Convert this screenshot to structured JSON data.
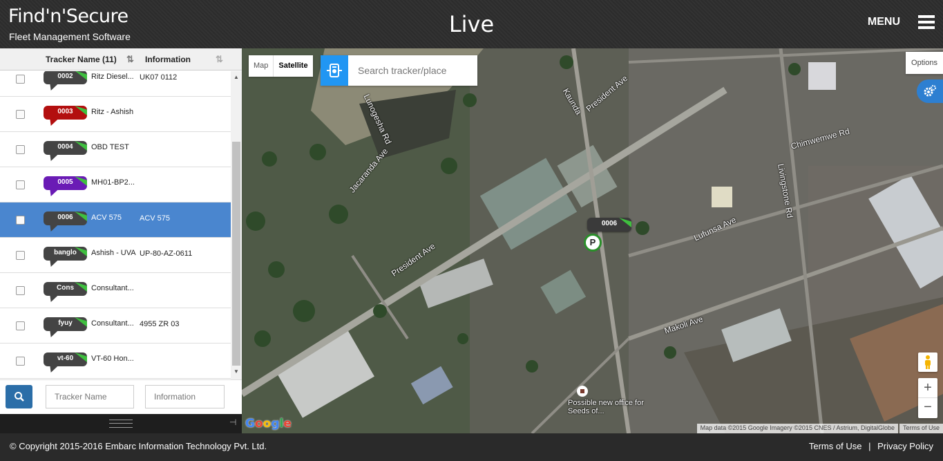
{
  "header": {
    "logo_text": "Find'n'Secure",
    "logo_subtitle": "Fleet Management Software",
    "page_title": "Live",
    "menu_label": "MENU"
  },
  "tracker_list": {
    "col_name": "Tracker Name (11)",
    "col_info": "Information",
    "rows": [
      {
        "badge": "0002",
        "badge_color": "#444444",
        "name": "Ritz Diesel...",
        "info": "UK07 0112",
        "selected": false
      },
      {
        "badge": "0003",
        "badge_color": "#b30f0f",
        "name": "Ritz - Ashish",
        "info": "",
        "selected": false
      },
      {
        "badge": "0004",
        "badge_color": "#444444",
        "name": "OBD TEST",
        "info": "",
        "selected": false
      },
      {
        "badge": "0005",
        "badge_color": "#6a1bb5",
        "name": "MH01-BP2...",
        "info": "",
        "selected": false
      },
      {
        "badge": "0006",
        "badge_color": "#444444",
        "name": "ACV 575",
        "info": "ACV 575",
        "selected": true
      },
      {
        "badge": "banglo",
        "badge_color": "#444444",
        "name": "Ashish - UVA",
        "info": "UP-80-AZ-0611",
        "selected": false
      },
      {
        "badge": "Cons",
        "badge_color": "#444444",
        "name": "Consultant...",
        "info": "",
        "selected": false
      },
      {
        "badge": "fyuy",
        "badge_color": "#444444",
        "name": "Consultant...",
        "info": "4955 ZR 03",
        "selected": false
      },
      {
        "badge": "vt-60",
        "badge_color": "#444444",
        "name": "VT-60 Hon...",
        "info": "",
        "selected": false
      }
    ]
  },
  "filters": {
    "name_placeholder": "Tracker Name",
    "info_placeholder": "Information"
  },
  "map": {
    "type_map": "Map",
    "type_satellite": "Satellite",
    "search_placeholder": "Search tracker/place",
    "options_label": "Options",
    "zoom_in": "+",
    "zoom_out": "−",
    "google_logo": "Google",
    "attribution": "Map data ©2015 Google Imagery ©2015 CNES / Astrium, DigitalGlobe",
    "terms": "Terms of Use",
    "marker_label": "0006",
    "parking_icon": "P",
    "poi_label": "Possible new office for Seeds of...",
    "streets": {
      "president_ave": "President Ave",
      "kaunda": "Kaunda",
      "president_ave_2": "President Ave",
      "jacaranda": "Jacaranda Ave",
      "lunogesha": "Lunogesha Rd",
      "chimwemwe": "Chimwemwe Rd",
      "livingstone": "Livingstone Rd",
      "lufunsa": "Lufunsa Ave",
      "makoli": "Makoli Ave"
    }
  },
  "footer": {
    "copyright": "© Copyright 2015-2016 Embarc Information Technology Pvt. Ltd.",
    "terms": "Terms of Use",
    "separator": "|",
    "privacy": "Privacy Policy"
  }
}
